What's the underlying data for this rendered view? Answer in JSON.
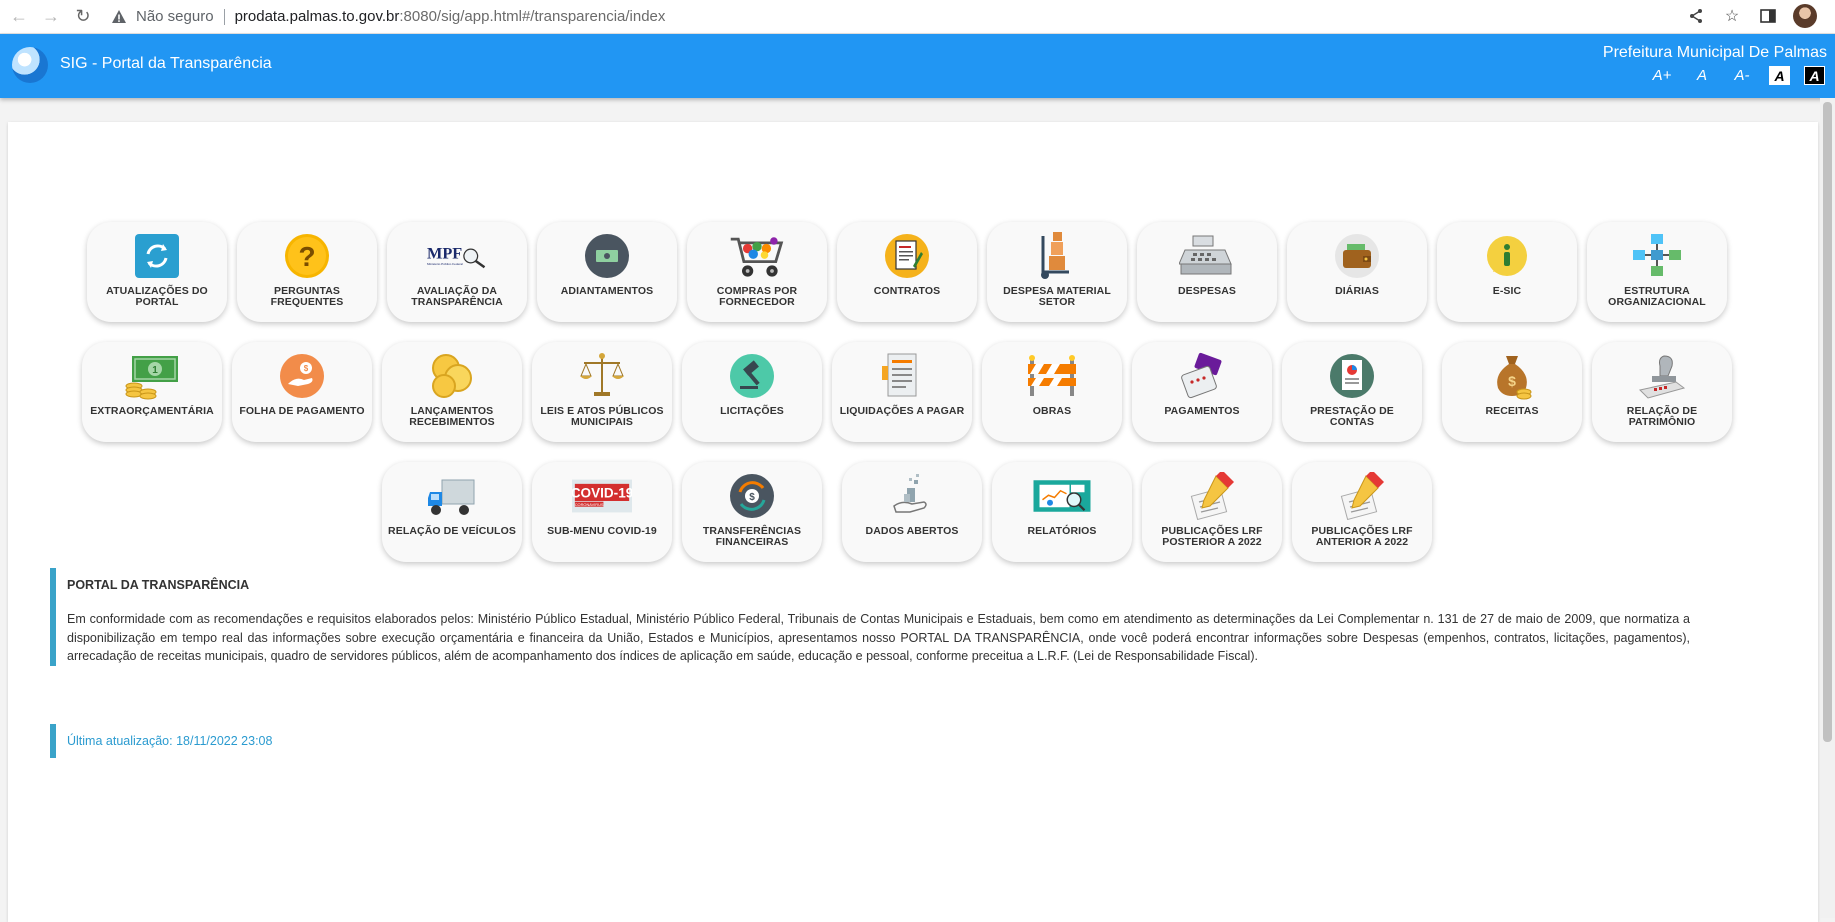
{
  "browser": {
    "security_label": "Não seguro",
    "url_host": "prodata.palmas.to.gov.br",
    "url_path": ":8080/sig/app.html#/transparencia/index"
  },
  "header": {
    "title": "SIG - Portal da Transparência",
    "city": "Prefeitura Municipal De Palmas",
    "font_increase": "A+",
    "font_normal": "A",
    "font_decrease": "A-",
    "contrast_light": "A",
    "contrast_dark": "A"
  },
  "tiles": [
    {
      "label": "ATUALIZAÇÕES DO PORTAL",
      "icon": "refresh-icon"
    },
    {
      "label": "PERGUNTAS FREQUENTES",
      "icon": "question-icon"
    },
    {
      "label": "AVALIAÇÃO DA TRANSPARÊNCIA",
      "icon": "mpf-logo-icon"
    },
    {
      "label": "ADIANTAMENTOS",
      "icon": "money-icon"
    },
    {
      "label": "COMPRAS POR FORNECEDOR",
      "icon": "cart-icon"
    },
    {
      "label": "CONTRATOS",
      "icon": "contract-icon"
    },
    {
      "label": "DESPESA MATERIAL SETOR",
      "icon": "hand-truck-icon"
    },
    {
      "label": "DESPESAS",
      "icon": "cash-register-icon"
    },
    {
      "label": "DIÁRIAS",
      "icon": "wallet-icon"
    },
    {
      "label": "E-SIC",
      "icon": "info-icon"
    },
    {
      "label": "ESTRUTURA ORGANIZACIONAL",
      "icon": "org-chart-icon"
    },
    {
      "label": "EXTRAORÇAMENTÁRIA",
      "icon": "banknote-coins-icon"
    },
    {
      "label": "FOLHA DE PAGAMENTO",
      "icon": "hand-coin-icon"
    },
    {
      "label": "LANÇAMENTOS RECEBIMENTOS",
      "icon": "gold-coins-icon"
    },
    {
      "label": "LEIS E ATOS PÚBLICOS MUNICIPAIS",
      "icon": "scales-icon"
    },
    {
      "label": "LICITAÇÕES",
      "icon": "gavel-icon"
    },
    {
      "label": "LIQUIDAÇÕES A PAGAR",
      "icon": "document-list-icon"
    },
    {
      "label": "OBRAS",
      "icon": "barrier-icon"
    },
    {
      "label": "PAGAMENTOS",
      "icon": "card-machine-icon"
    },
    {
      "label": "PRESTAÇÃO DE CONTAS",
      "icon": "report-chart-icon"
    },
    {
      "label": "RECEITAS",
      "icon": "money-bag-icon"
    },
    {
      "label": "RELAÇÃO DE PATRIMÔNIO",
      "icon": "stamp-icon"
    },
    {
      "label": "RELAÇÃO DE VEÍCULOS",
      "icon": "truck-icon"
    },
    {
      "label": "SUB-MENU COVID-19",
      "icon": "covid-banner-icon",
      "banner_text": "COVID-19",
      "banner_sub": "CORONAVIRUS"
    },
    {
      "label": "TRANSFERÊNCIAS FINANCEIRAS",
      "icon": "transfer-icon"
    },
    {
      "label": "DADOS ABERTOS",
      "icon": "open-data-icon"
    },
    {
      "label": "RELATÓRIOS",
      "icon": "reports-icon"
    },
    {
      "label": "PUBLICAÇÕES LRF POSTERIOR A 2022",
      "icon": "pencil-doc-icon"
    },
    {
      "label": "PUBLICAÇÕES LRF ANTERIOR A 2022",
      "icon": "pencil-doc-icon"
    }
  ],
  "portal": {
    "title": "PORTAL DA TRANSPARÊNCIA",
    "text": "Em conformidade com as recomendações e requisitos elaborados pelos: Ministério Público Estadual, Ministério Público Federal, Tribunais de Contas Municipais e Estaduais, bem como em atendimento as determinações da Lei Complementar n. 131 de 27 de maio de 2009, que normatiza a disponibilização em tempo real das informações sobre execução orçamentária e financeira da União, Estados e Municípios, apresentamos nosso PORTAL DA TRANSPARÊNCIA, onde você poderá encontrar informações sobre Despesas (empenhos, contratos, licitações, pagamentos), arrecadação de receitas municipais, quadro de servidores públicos, além de acompanhamento dos índices de aplicação em saúde, educação e pessoal, conforme preceitua a L.R.F. (Lei de Responsabilidade Fiscal)."
  },
  "last_update": "Última atualização: 18/11/2022 23:08",
  "colors": {
    "appbar": "#2196f3",
    "accent": "#3aa3c9",
    "update_text": "#2b9bd0"
  }
}
